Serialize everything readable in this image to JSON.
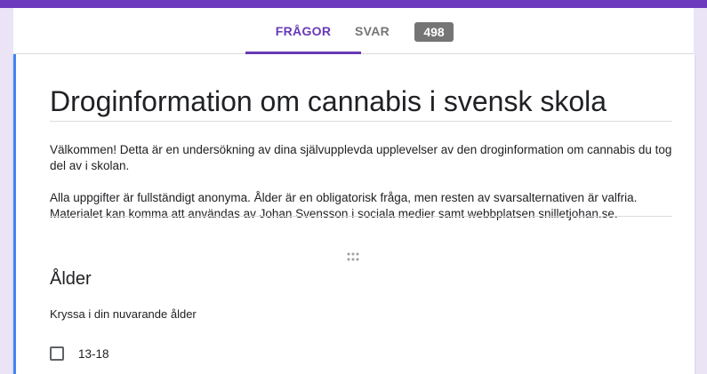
{
  "tabs": [
    {
      "label": "FRÅGOR",
      "active": true
    },
    {
      "label": "SVAR",
      "active": false
    }
  ],
  "responses_count": "498",
  "form": {
    "title": "Droginformation om cannabis i svensk skola",
    "description": [
      "Välkommen! Detta är en undersökning av dina självupplevda upplevelser av den droginformation om cannabis du tog del av i skolan.",
      "Alla uppgifter är fullständigt anonyma. Ålder är en obligatorisk fråga, men resten av svarsalternativen är valfria. Materialet kan komma att användas av Johan Svensson i sociala medier samt webbplatsen snilletjohan.se."
    ]
  },
  "question": {
    "title": "Ålder",
    "help": "Kryssa i din nuvarande ålder",
    "options": [
      "13-18"
    ],
    "drag_icon": "drag-handle-icon"
  },
  "colors": {
    "accent": "#673ab7",
    "header_band": "#6c3bbd",
    "background": "#ebe4f7",
    "card_left_border": "#4285f4",
    "badge": "#757575"
  }
}
